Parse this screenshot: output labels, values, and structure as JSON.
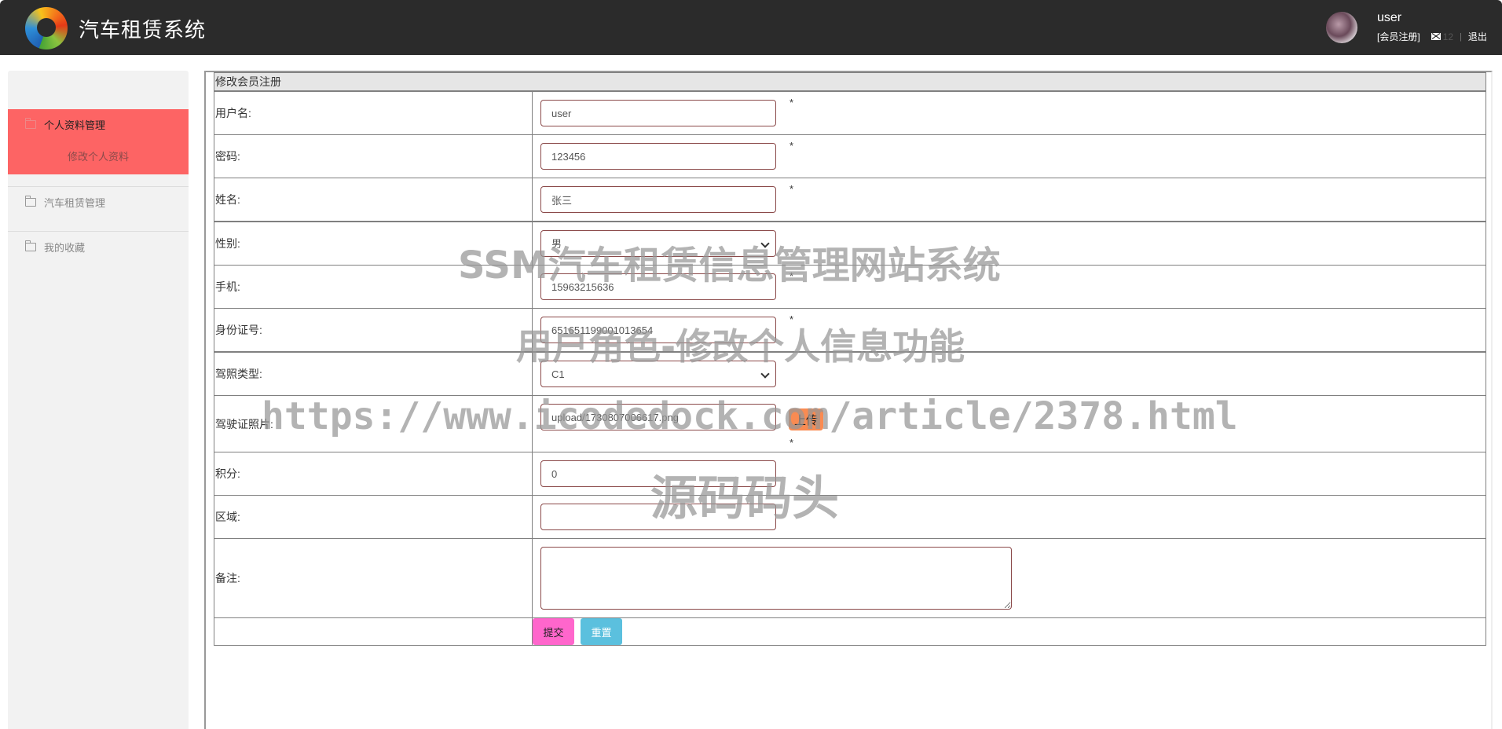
{
  "header": {
    "app_title": "汽车租赁系统",
    "username": "user",
    "member_link": "[会员注册]",
    "message_count": "12",
    "separator": "|",
    "logout_label": "退出"
  },
  "sidebar": {
    "groups": [
      {
        "label": "个人资料管理",
        "active": true,
        "children": [
          {
            "label": "修改个人资料"
          }
        ]
      },
      {
        "label": "汽车租赁管理",
        "active": false
      },
      {
        "label": "我的收藏",
        "active": false
      }
    ]
  },
  "form": {
    "caption": "修改会员注册",
    "required_mark": "*",
    "fields": {
      "username": {
        "label": "用户名:",
        "value": "user"
      },
      "password": {
        "label": "密码:",
        "value": "123456"
      },
      "name": {
        "label": "姓名:",
        "value": "张三"
      },
      "gender": {
        "label": "性别:",
        "value": "男"
      },
      "phone": {
        "label": "手机:",
        "value": "15963215636"
      },
      "id_number": {
        "label": "身份证号:",
        "value": "651651199001013654"
      },
      "license_type": {
        "label": "驾照类型:",
        "value": "C1"
      },
      "license_photo": {
        "label": "驾驶证照片:",
        "value": "upload/1730807006617.png",
        "upload_label": "上传"
      },
      "points": {
        "label": "积分:",
        "value": "0"
      },
      "region": {
        "label": "区域:",
        "value": ""
      },
      "notes": {
        "label": "备注:",
        "value": ""
      }
    },
    "submit_label": "提交",
    "reset_label": "重置"
  },
  "watermark": {
    "line1": "SSM汽车租赁信息管理网站系统",
    "line2": "用户角色-修改个人信息功能",
    "line3": "https://www.icodedock.com/article/2378.html",
    "line4": "源码码头"
  },
  "colors": {
    "header_bg": "#2b2b2b",
    "sidebar_active": "#fd6464",
    "submit_button": "#ff66cc",
    "reset_button": "#5bc0de",
    "upload_button": "#f98b52"
  }
}
